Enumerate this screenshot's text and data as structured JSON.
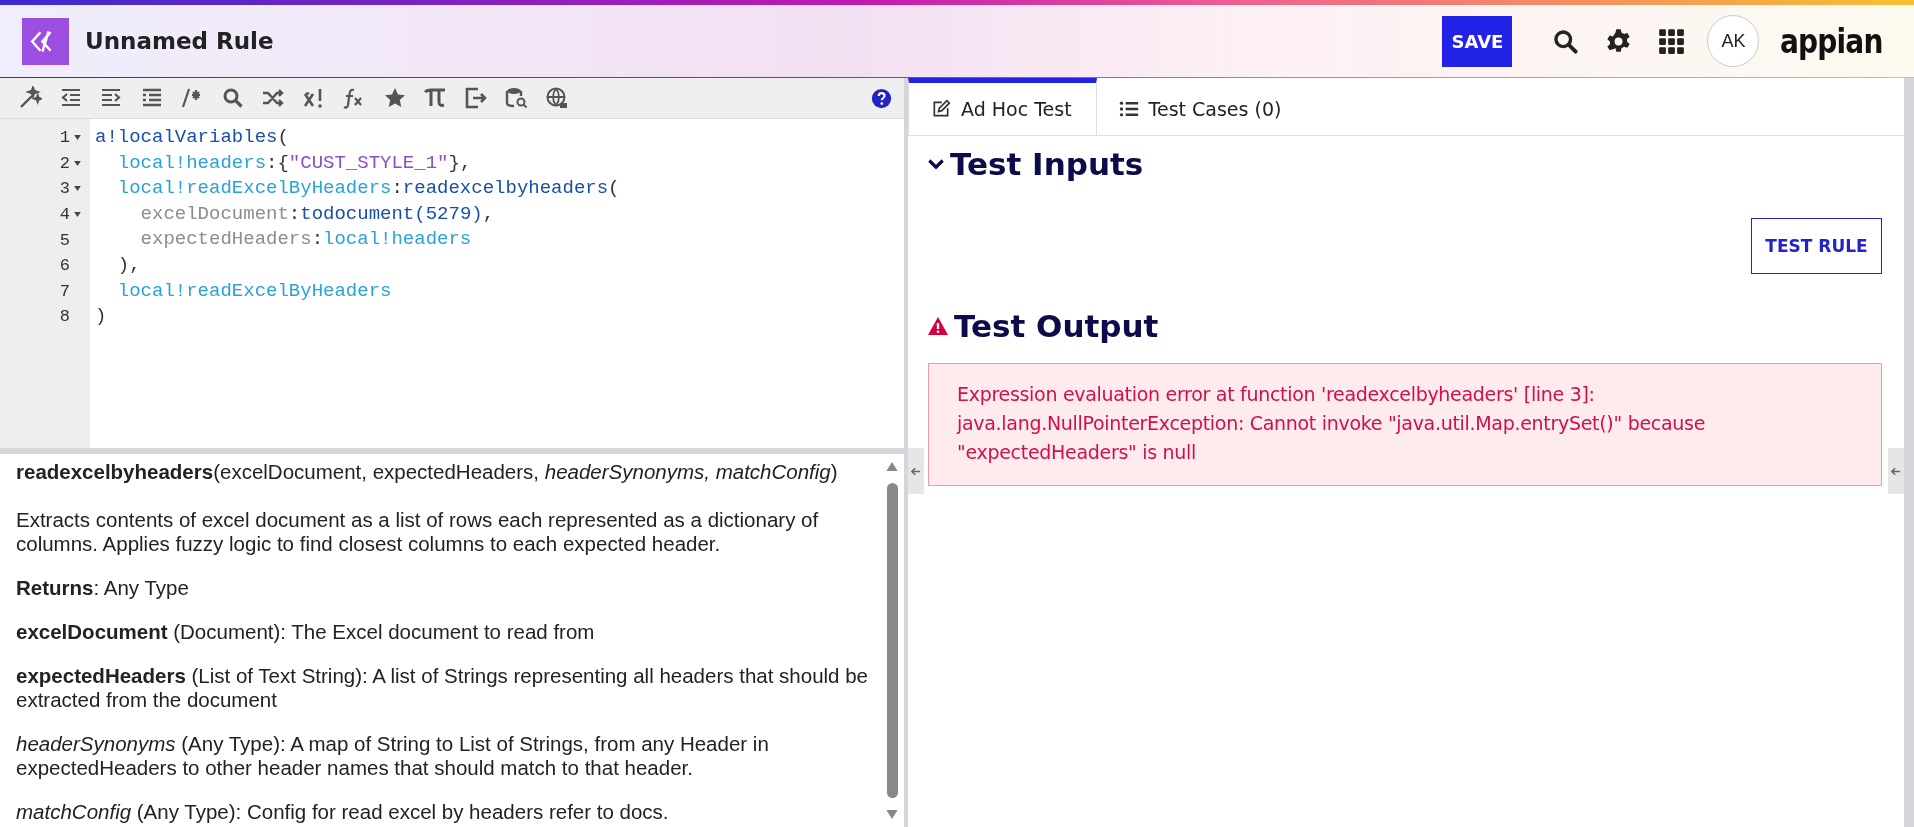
{
  "header": {
    "title": "Unnamed Rule",
    "save_label": "SAVE",
    "avatar": "AK",
    "logo": "appian"
  },
  "code_lines": [
    {
      "number": "1",
      "foldable": true,
      "tokens": [
        {
          "kind": "fn",
          "text": "a!localVariables"
        },
        {
          "kind": "punc",
          "text": "("
        }
      ]
    },
    {
      "number": "2",
      "foldable": true,
      "tokens": [
        {
          "kind": "var",
          "text": "  local!headers"
        },
        {
          "kind": "punc",
          "text": ":{"
        },
        {
          "kind": "str",
          "text": "\"CUST_STYLE_1\""
        },
        {
          "kind": "punc",
          "text": "},"
        }
      ]
    },
    {
      "number": "3",
      "foldable": true,
      "tokens": [
        {
          "kind": "var",
          "text": "  local!readExcelByHeaders"
        },
        {
          "kind": "punc",
          "text": ":"
        },
        {
          "kind": "fn",
          "text": "readexcelbyheaders"
        },
        {
          "kind": "punc",
          "text": "("
        }
      ]
    },
    {
      "number": "4",
      "foldable": true,
      "tokens": [
        {
          "kind": "param",
          "text": "    excelDocument"
        },
        {
          "kind": "punc",
          "text": ":"
        },
        {
          "kind": "fn",
          "text": "todocument"
        },
        {
          "kind": "fn",
          "text": "(5279)"
        },
        {
          "kind": "punc",
          "text": ","
        }
      ]
    },
    {
      "number": "5",
      "foldable": false,
      "tokens": [
        {
          "kind": "param",
          "text": "    expectedHeaders"
        },
        {
          "kind": "punc",
          "text": ":"
        },
        {
          "kind": "var",
          "text": "local!headers"
        }
      ]
    },
    {
      "number": "6",
      "foldable": false,
      "tokens": [
        {
          "kind": "punc",
          "text": "  ),"
        }
      ]
    },
    {
      "number": "7",
      "foldable": false,
      "tokens": [
        {
          "kind": "var",
          "text": "  local!readExcelByHeaders"
        }
      ]
    },
    {
      "number": "8",
      "foldable": false,
      "tokens": [
        {
          "kind": "punc",
          "text": ")"
        }
      ]
    }
  ],
  "doc": {
    "signature": "**readexcelbyheaders**(excelDocument, expectedHeaders, *headerSynonyms, matchConfig*)",
    "paragraphs": [
      "Extracts contents of excel document as a list of rows each represented as a dictionary of columns. Applies fuzzy logic to find closest columns to each expected header.",
      "**Returns**: Any Type",
      "**excelDocument** (Document): The Excel document to read from",
      "**expectedHeaders** (List of Text String): A list of Strings representing all headers that should be extracted from the document",
      "*headerSynonyms* (Any Type): A map of String to List of Strings, from any Header in expectedHeaders to other header names that should match to that header.",
      "*matchConfig* (Any Type): Config for read excel by headers refer to docs."
    ]
  },
  "tabs": [
    {
      "label": "Ad Hoc Test",
      "kind": "edit",
      "selected": true
    },
    {
      "label": "Test Cases (0)",
      "kind": "list",
      "selected": false
    }
  ],
  "test_inputs": {
    "title": "Test Inputs",
    "expanded": true,
    "button": "TEST RULE"
  },
  "test_output": {
    "title": "Test Output",
    "error": "Expression evaluation error at function 'readexcelbyheaders' [line 3]: java.lang.NullPointerException: Cannot invoke \"java.util.Map.entrySet()\" because \"expectedHeaders\" is null"
  }
}
